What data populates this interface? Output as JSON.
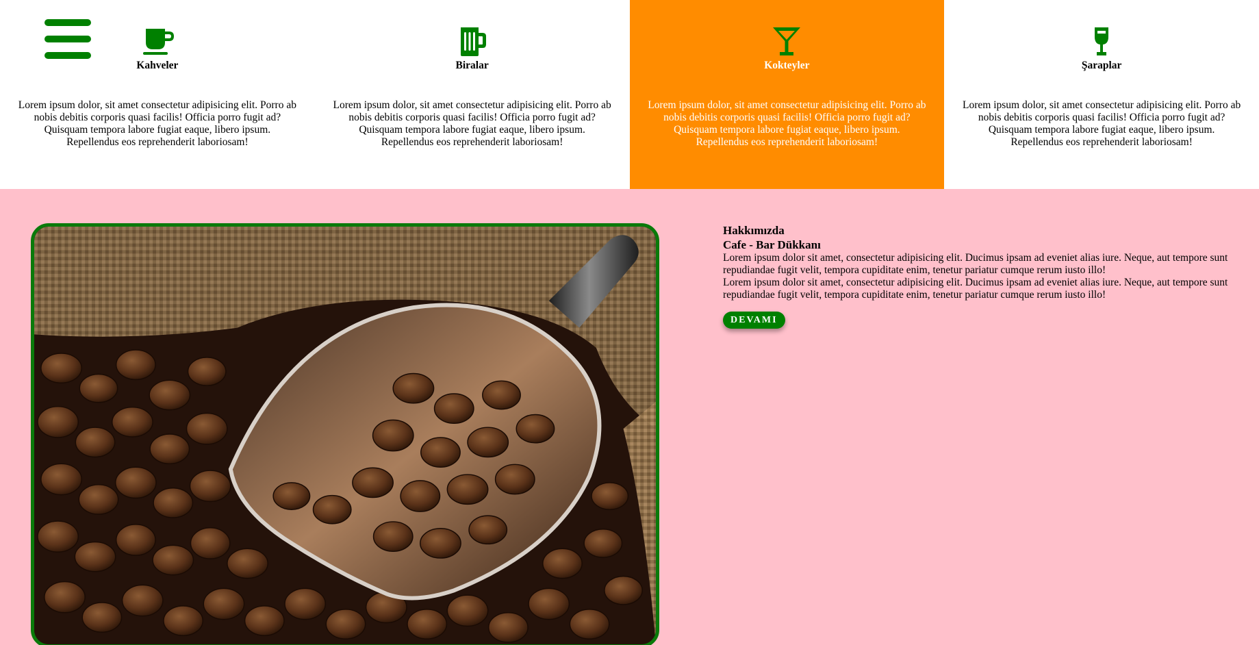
{
  "nav": {
    "menu_icon": "hamburger-menu-icon"
  },
  "accent_color": "#008000",
  "highlight_color": "#ff8c00",
  "section_background": "#ffc0cb",
  "services": [
    {
      "icon": "coffee-cup-icon",
      "title": "Kahveler",
      "text": "Lorem ipsum dolor, sit amet consectetur adipisicing elit. Porro ab nobis debitis corporis quasi facilis! Officia porro fugit ad? Quisquam tempora labore fugiat eaque, libero ipsum. Repellendus eos reprehenderit laboriosam!"
    },
    {
      "icon": "beer-mug-icon",
      "title": "Biralar",
      "text": "Lorem ipsum dolor, sit amet consectetur adipisicing elit. Porro ab nobis debitis corporis quasi facilis! Officia porro fugit ad? Quisquam tempora labore fugiat eaque, libero ipsum. Repellendus eos reprehenderit laboriosam!"
    },
    {
      "icon": "cocktail-glass-icon",
      "title": "Kokteyler",
      "text": "Lorem ipsum dolor, sit amet consectetur adipisicing elit. Porro ab nobis debitis corporis quasi facilis! Officia porro fugit ad? Quisquam tempora labore fugiat eaque, libero ipsum. Repellendus eos reprehenderit laboriosam!"
    },
    {
      "icon": "wine-glass-icon",
      "title": "Şaraplar",
      "text": "Lorem ipsum dolor, sit amet consectetur adipisicing elit. Porro ab nobis debitis corporis quasi facilis! Officia porro fugit ad? Quisquam tempora labore fugiat eaque, libero ipsum. Repellendus eos reprehenderit laboriosam!"
    }
  ],
  "about": {
    "image": "coffee-beans-scoop-photo",
    "title": "Hakkımızda",
    "subtitle": "Cafe - Bar Dükkanı",
    "paragraphs": [
      "Lorem ipsum dolor sit amet, consectetur adipisicing elit. Ducimus ipsam ad eveniet alias iure. Neque, aut tempore sunt repudiandae fugit velit, tempora cupiditate enim, tenetur pariatur cumque rerum iusto illo!",
      "Lorem ipsum dolor sit amet, consectetur adipisicing elit. Ducimus ipsam ad eveniet alias iure. Neque, aut tempore sunt repudiandae fugit velit, tempora cupiditate enim, tenetur pariatur cumque rerum iusto illo!"
    ],
    "button_label": "DEVAMI"
  }
}
